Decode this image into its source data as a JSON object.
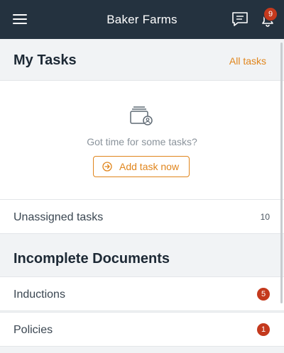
{
  "app": {
    "title": "Baker Farms"
  },
  "header": {
    "notification_count": "9"
  },
  "my_tasks": {
    "heading": "My Tasks",
    "all_tasks_link": "All tasks",
    "empty_message": "Got time for some tasks?",
    "add_task_label": "Add task now"
  },
  "unassigned": {
    "label": "Unassigned tasks",
    "count": "10"
  },
  "incomplete_documents": {
    "heading": "Incomplete Documents",
    "items": [
      {
        "label": "Inductions",
        "badge": "5"
      },
      {
        "label": "Policies",
        "badge": "1"
      }
    ]
  },
  "colors": {
    "topbar": "#24323f",
    "accent": "#e0851c",
    "badge": "#c4391d"
  }
}
